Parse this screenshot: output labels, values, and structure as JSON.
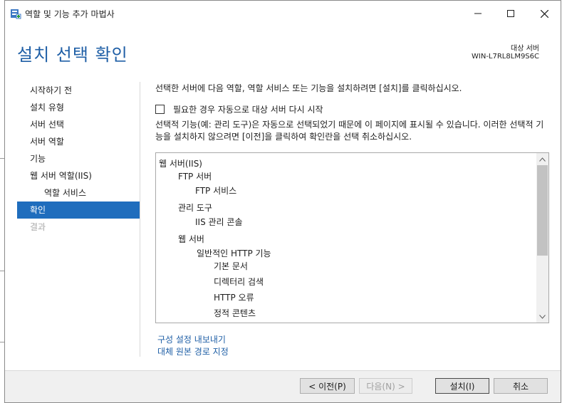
{
  "window": {
    "title": "역할 및 기능 추가 마법사",
    "minimize_glyph": "—",
    "maximize_glyph": "☐",
    "close_glyph": "✕"
  },
  "header": {
    "page_title": "설치 선택 확인",
    "target_label": "대상 서버",
    "target_name": "WIN-L7RL8LM9S6C"
  },
  "nav": {
    "items": [
      {
        "label": "시작하기 전",
        "state": "normal"
      },
      {
        "label": "설치 유형",
        "state": "normal"
      },
      {
        "label": "서버 선택",
        "state": "normal"
      },
      {
        "label": "서버 역할",
        "state": "normal"
      },
      {
        "label": "기능",
        "state": "normal"
      },
      {
        "label": "웹 서버 역할(IIS)",
        "state": "normal"
      },
      {
        "label": "역할 서비스",
        "state": "sub"
      },
      {
        "label": "확인",
        "state": "active"
      },
      {
        "label": "결과",
        "state": "disabled"
      }
    ]
  },
  "content": {
    "intro": "선택한 서버에 다음 역할, 역할 서비스 또는 기능을 설치하려면 [설치]를 클릭하십시오.",
    "restart_checkbox_label": "필요한 경우 자동으로 대상 서버 다시 시작",
    "restart_checked": false,
    "note": "선택적 기능(예: 관리 도구)은 자동으로 선택되었기 때문에 이 페이지에 표시될 수 있습니다. 이러한 선택적 기능을 설치하지 않으려면 [이전]을 클릭하여 확인란을 선택 취소하십시오."
  },
  "selection_list": {
    "items": [
      {
        "label": "웹 서버(IIS)",
        "level": 0
      },
      {
        "label": "FTP 서버",
        "level": 1
      },
      {
        "label": "FTP 서비스",
        "level": 2
      },
      {
        "label": "관리 도구",
        "level": 1
      },
      {
        "label": "IIS 관리 콘솔",
        "level": 2
      },
      {
        "label": "웹 서버",
        "level": 1
      },
      {
        "label": "일반적인 HTTP 기능",
        "level": 2
      },
      {
        "label": "기본 문서",
        "level": 3
      },
      {
        "label": "디렉터리 검색",
        "level": 3
      },
      {
        "label": "HTTP 오류",
        "level": 3
      },
      {
        "label": "정적 콘텐츠",
        "level": 3
      }
    ]
  },
  "links": {
    "export": "구성 설정 내보내기",
    "alternate_source": "대체 원본 경로 지정"
  },
  "footer": {
    "prev": "< 이전(P)",
    "next": "다음(N) >",
    "install": "설치(I)",
    "cancel": "취소"
  },
  "colors": {
    "accent": "#1f6dbd",
    "title_blue": "#1f5fa6",
    "footer_bg": "#f0f0f0"
  }
}
